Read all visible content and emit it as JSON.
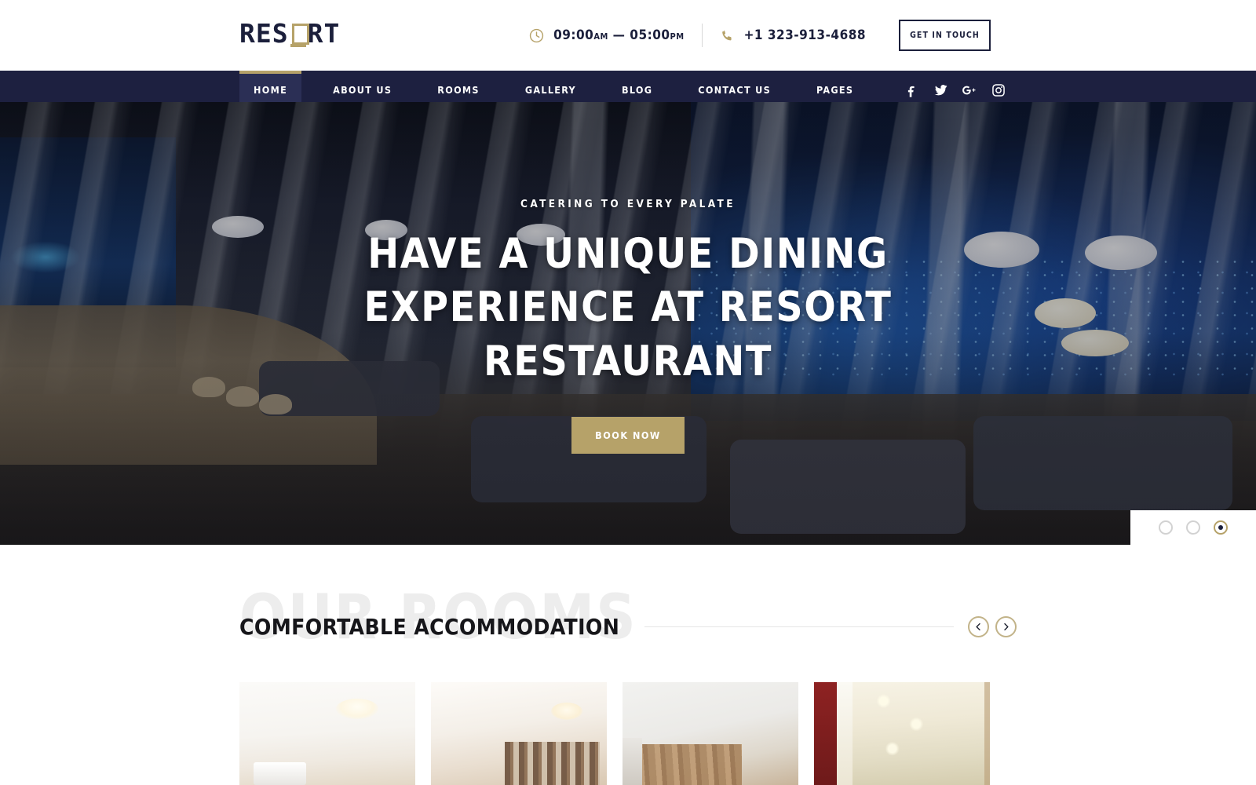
{
  "brand": {
    "name_part1": "RES",
    "name_o": "O",
    "name_part2": "RT"
  },
  "header": {
    "hours_icon": "clock-icon",
    "hours_open": "09:00",
    "hours_open_suffix": "AM",
    "hours_dash": "—",
    "hours_close": "05:00",
    "hours_close_suffix": "PM",
    "phone_icon": "phone-icon",
    "phone": "+1 323-913-4688",
    "cta_label": "GET IN TOUCH"
  },
  "nav": {
    "items": [
      {
        "label": "HOME",
        "active": true
      },
      {
        "label": "ABOUT US",
        "active": false
      },
      {
        "label": "ROOMS",
        "active": false
      },
      {
        "label": "GALLERY",
        "active": false
      },
      {
        "label": "BLOG",
        "active": false
      },
      {
        "label": "CONTACT US",
        "active": false
      },
      {
        "label": "PAGES",
        "active": false
      }
    ],
    "social": [
      {
        "name": "facebook-icon"
      },
      {
        "name": "twitter-icon"
      },
      {
        "name": "google-plus-icon"
      },
      {
        "name": "instagram-icon"
      }
    ]
  },
  "hero": {
    "eyebrow": "CATERING TO EVERY PALATE",
    "title": "HAVE A UNIQUE DINING EXPERIENCE AT RESORT RESTAURANT",
    "cta_label": "BOOK NOW",
    "slides_total": 3,
    "slide_active_index": 3
  },
  "rooms": {
    "watermark": "OUR ROOMS",
    "title": "COMFORTABLE ACCOMMODATION",
    "prev_icon": "chevron-left-icon",
    "next_icon": "chevron-right-icon",
    "cards": [
      {
        "name": "room-card-1"
      },
      {
        "name": "room-card-2"
      },
      {
        "name": "room-card-3"
      },
      {
        "name": "room-card-4"
      }
    ]
  },
  "colors": {
    "navy": "#1d2040",
    "gold": "#b6a269",
    "dark_text": "#16161a",
    "watermark_grey": "#ededed"
  }
}
